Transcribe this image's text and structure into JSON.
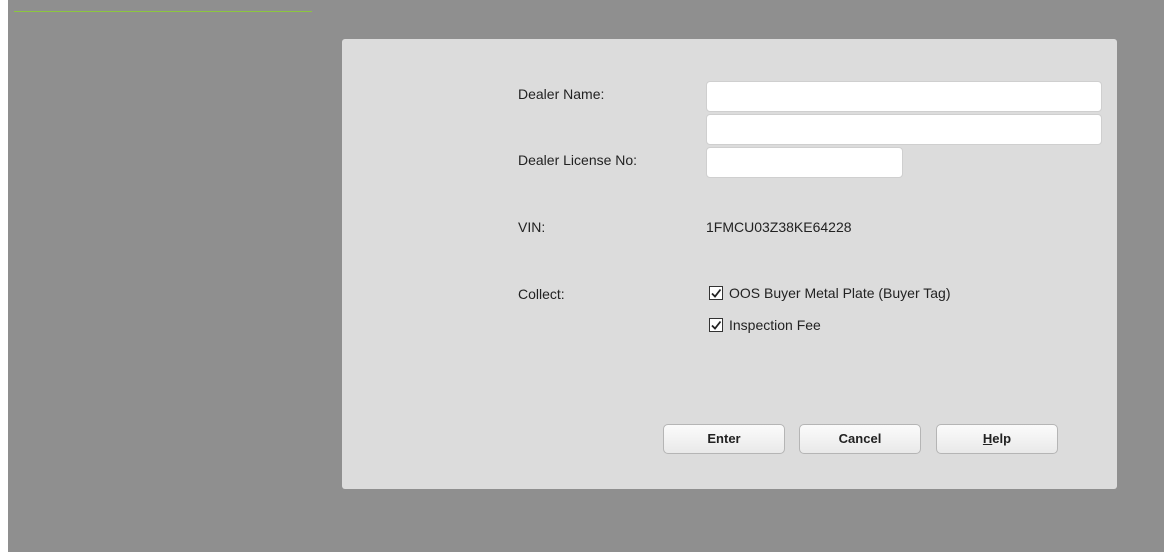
{
  "form": {
    "dealer_name_label": "Dealer Name:",
    "dealer_name_line1": "",
    "dealer_name_line2": "",
    "dealer_license_label": "Dealer License No:",
    "dealer_license_value": "",
    "vin_label": "VIN:",
    "vin_value": "1FMCU03Z38KE64228",
    "collect_label": "Collect:",
    "collect_items": [
      {
        "label": "OOS Buyer Metal Plate (Buyer Tag)",
        "checked": true
      },
      {
        "label": "Inspection Fee",
        "checked": true
      }
    ]
  },
  "buttons": {
    "enter": "Enter",
    "cancel": "Cancel",
    "help_first": "H",
    "help_rest": "elp"
  },
  "colors": {
    "backdrop": "#8f8f8f",
    "panel": "#dcdcdc",
    "accent_line": "#8cc63f"
  }
}
